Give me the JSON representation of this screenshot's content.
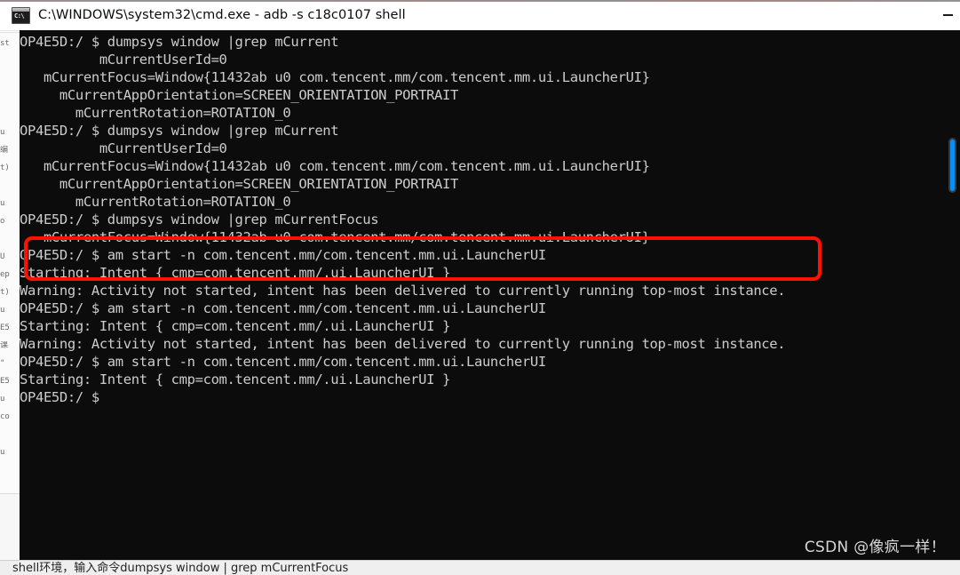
{
  "window": {
    "title": "C:\\WINDOWS\\system32\\cmd.exe - adb  -s c18c0107 shell",
    "icon": "cmd-icon",
    "minimize_label": "–"
  },
  "terminal": {
    "background_color": "#0c0c0c",
    "text_color": "#cccccc",
    "lines": [
      "OP4E5D:/ $ dumpsys window |grep mCurrent",
      "          mCurrentUserId=0",
      "   mCurrentFocus=Window{11432ab u0 com.tencent.mm/com.tencent.mm.ui.LauncherUI}",
      "     mCurrentAppOrientation=SCREEN_ORIENTATION_PORTRAIT",
      "       mCurrentRotation=ROTATION_0",
      "OP4E5D:/ $ dumpsys window |grep mCurrent",
      "          mCurrentUserId=0",
      "   mCurrentFocus=Window{11432ab u0 com.tencent.mm/com.tencent.mm.ui.LauncherUI}",
      "     mCurrentAppOrientation=SCREEN_ORIENTATION_PORTRAIT",
      "       mCurrentRotation=ROTATION_0",
      "OP4E5D:/ $ dumpsys window |grep mCurrentFocus",
      "   mCurrentFocus=Window{11432ab u0 com.tencent.mm/com.tencent.mm.ui.LauncherUI}",
      "OP4E5D:/ $ am start -n com.tencent.mm/com.tencent.mm.ui.LauncherUI",
      "Starting: Intent { cmp=com.tencent.mm/.ui.LauncherUI }",
      "Warning: Activity not started, intent has been delivered to currently running top-most instance.",
      "OP4E5D:/ $ am start -n com.tencent.mm/com.tencent.mm.ui.LauncherUI",
      "Starting: Intent { cmp=com.tencent.mm/.ui.LauncherUI }",
      "Warning: Activity not started, intent has been delivered to currently running top-most instance.",
      "OP4E5D:/ $ am start -n com.tencent.mm/com.tencent.mm.ui.LauncherUI",
      "Starting: Intent { cmp=com.tencent.mm/.ui.LauncherUI }",
      "OP4E5D:/ $"
    ],
    "watermark": "CSDN @像疯一样！"
  },
  "annotation": {
    "color": "#fc1202",
    "covers_lines": [
      10,
      11
    ]
  },
  "scrollbar": {
    "thumb_color": "#0b8ff5",
    "track_color": "#3b3b3b"
  },
  "background": {
    "status_text": "shell环境，输入命令dumpsys window | grep mCurrentFocus",
    "gutter_fragments": [
      "st",
      "",
      "",
      "",
      "",
      "u",
      "编",
      "t)",
      "",
      "u",
      "o",
      "",
      "U",
      "ep",
      "t)",
      "u",
      "E5",
      "课",
      "\"",
      "E5",
      "u",
      "co",
      "",
      "u"
    ]
  }
}
